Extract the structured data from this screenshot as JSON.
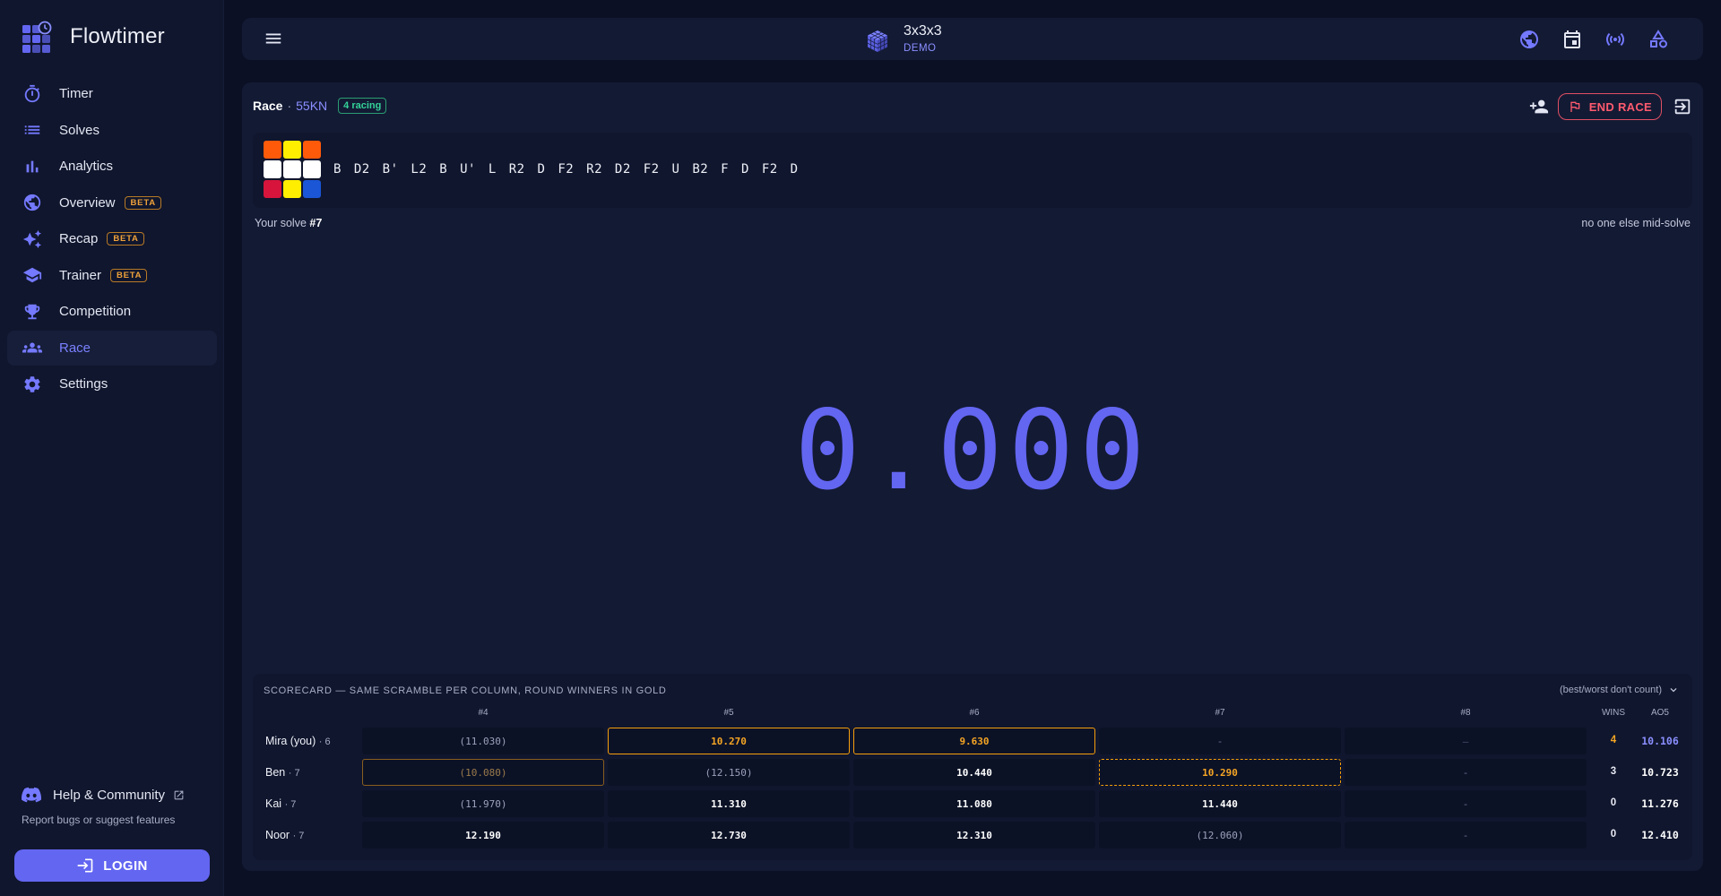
{
  "app": {
    "name": "Flowtimer"
  },
  "nav": {
    "items": [
      {
        "label": "Timer",
        "icon": "timer-icon",
        "badge": ""
      },
      {
        "label": "Solves",
        "icon": "list-icon",
        "badge": ""
      },
      {
        "label": "Analytics",
        "icon": "bar-chart-icon",
        "badge": ""
      },
      {
        "label": "Overview",
        "icon": "globe-icon",
        "badge": "BETA"
      },
      {
        "label": "Recap",
        "icon": "sparkle-icon",
        "badge": "BETA"
      },
      {
        "label": "Trainer",
        "icon": "graduation-cap-icon",
        "badge": "BETA"
      },
      {
        "label": "Competition",
        "icon": "trophy-icon",
        "badge": ""
      },
      {
        "label": "Race",
        "icon": "group-icon",
        "badge": "",
        "active": true
      },
      {
        "label": "Settings",
        "icon": "gear-icon",
        "badge": ""
      }
    ],
    "help_label": "Help & Community",
    "help_sub": "Report bugs or suggest features",
    "login_label": "LOGIN"
  },
  "topbar": {
    "puzzle_name": "3x3x3",
    "puzzle_sub": "DEMO"
  },
  "race": {
    "title": "Race",
    "separator": "·",
    "code": "55KN",
    "racing_badge": "4 racing",
    "end_label": "END RACE",
    "scramble": "B D2 B' L2 B U' L R2 D F2 R2 D2 F2 U B2 F D F2 D",
    "cube_colors": [
      "#ff5a0a",
      "#ffee00",
      "#ff5a0a",
      "#ffffff",
      "#ffffff",
      "#ffffff",
      "#d6143c",
      "#ffee00",
      "#1a56d6"
    ],
    "your_solve_prefix": "Your solve",
    "your_solve_num": "#7",
    "mid_solve": "no one else mid-solve",
    "timer": "0.000"
  },
  "scorecard": {
    "title": "SCORECARD — SAME SCRAMBLE PER COLUMN, ROUND WINNERS IN GOLD",
    "note": "(best/worst don't count)",
    "columns": [
      "#4",
      "#5",
      "#6",
      "#7",
      "#8"
    ],
    "wins_header": "WINS",
    "ao5_header": "AO5",
    "rows": [
      {
        "name": "Mira (you)",
        "count": "· 6",
        "cells": [
          {
            "v": "(11.030)",
            "s": "paren"
          },
          {
            "v": "10.270",
            "s": "gold"
          },
          {
            "v": "9.630",
            "s": "gold"
          },
          {
            "v": "-",
            "s": "empty"
          },
          {
            "v": "–",
            "s": "empty2"
          }
        ],
        "wins": "4",
        "ao5": "10.106",
        "wins_color": "#f5a524",
        "ao5_color": "#8a8fff"
      },
      {
        "name": "Ben",
        "count": "· 7",
        "cells": [
          {
            "v": "(10.080)",
            "s": "gold-muted"
          },
          {
            "v": "(12.150)",
            "s": "paren"
          },
          {
            "v": "10.440",
            "s": "plain"
          },
          {
            "v": "10.290",
            "s": "gold-dash"
          },
          {
            "v": "-",
            "s": "empty"
          }
        ],
        "wins": "3",
        "ao5": "10.723",
        "wins_color": "#e6e8f2",
        "ao5_color": "#ffffff"
      },
      {
        "name": "Kai",
        "count": "· 7",
        "cells": [
          {
            "v": "(11.970)",
            "s": "paren"
          },
          {
            "v": "11.310",
            "s": "plain"
          },
          {
            "v": "11.080",
            "s": "plain"
          },
          {
            "v": "11.440",
            "s": "plain"
          },
          {
            "v": "-",
            "s": "empty"
          }
        ],
        "wins": "0",
        "ao5": "11.276",
        "wins_color": "#e6e8f2",
        "ao5_color": "#ffffff"
      },
      {
        "name": "Noor",
        "count": "· 7",
        "cells": [
          {
            "v": "12.190",
            "s": "plain"
          },
          {
            "v": "12.730",
            "s": "plain"
          },
          {
            "v": "12.310",
            "s": "plain"
          },
          {
            "v": "(12.060)",
            "s": "paren"
          },
          {
            "v": "-",
            "s": "empty"
          }
        ],
        "wins": "0",
        "ao5": "12.410",
        "wins_color": "#e6e8f2",
        "ao5_color": "#ffffff"
      }
    ]
  }
}
